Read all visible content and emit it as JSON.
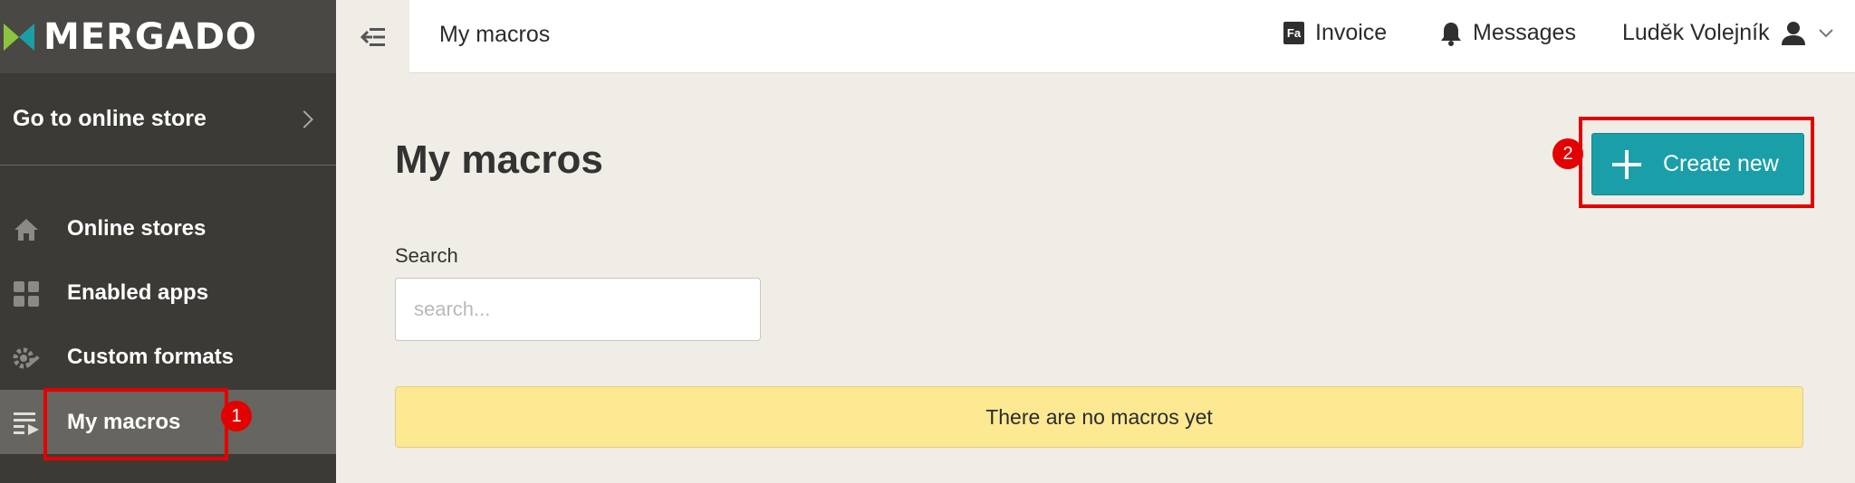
{
  "brand": {
    "name": "MERGADO"
  },
  "sidebar": {
    "store_link": "Go to online store",
    "items": [
      {
        "label": "Online stores",
        "icon": "home-icon"
      },
      {
        "label": "Enabled apps",
        "icon": "grid-icon"
      },
      {
        "label": "Custom formats",
        "icon": "cog-wrench-icon"
      },
      {
        "label": "My macros",
        "icon": "macros-list-icon",
        "active": true
      }
    ]
  },
  "topbar": {
    "title": "My macros",
    "invoice": {
      "badge": "Fa",
      "label": "Invoice"
    },
    "messages": {
      "label": "Messages"
    },
    "user": {
      "name": "Luděk Volejník"
    }
  },
  "main": {
    "title": "My macros",
    "search": {
      "label": "Search",
      "placeholder": "search...",
      "value": ""
    },
    "empty_message": "There are no macros yet",
    "create_button": "Create new"
  },
  "annotations": [
    {
      "number": "1",
      "target": "My macros"
    },
    {
      "number": "2",
      "target": "Create new"
    }
  ],
  "colors": {
    "sidebar_bg": "#3c3a35",
    "active_item_bg": "#67655f",
    "accent": "#1a9fa9",
    "notice_bg": "#fde992",
    "annotation": "#e30000",
    "logo_green": "#8bc53f",
    "logo_teal": "#1a9fa9"
  }
}
